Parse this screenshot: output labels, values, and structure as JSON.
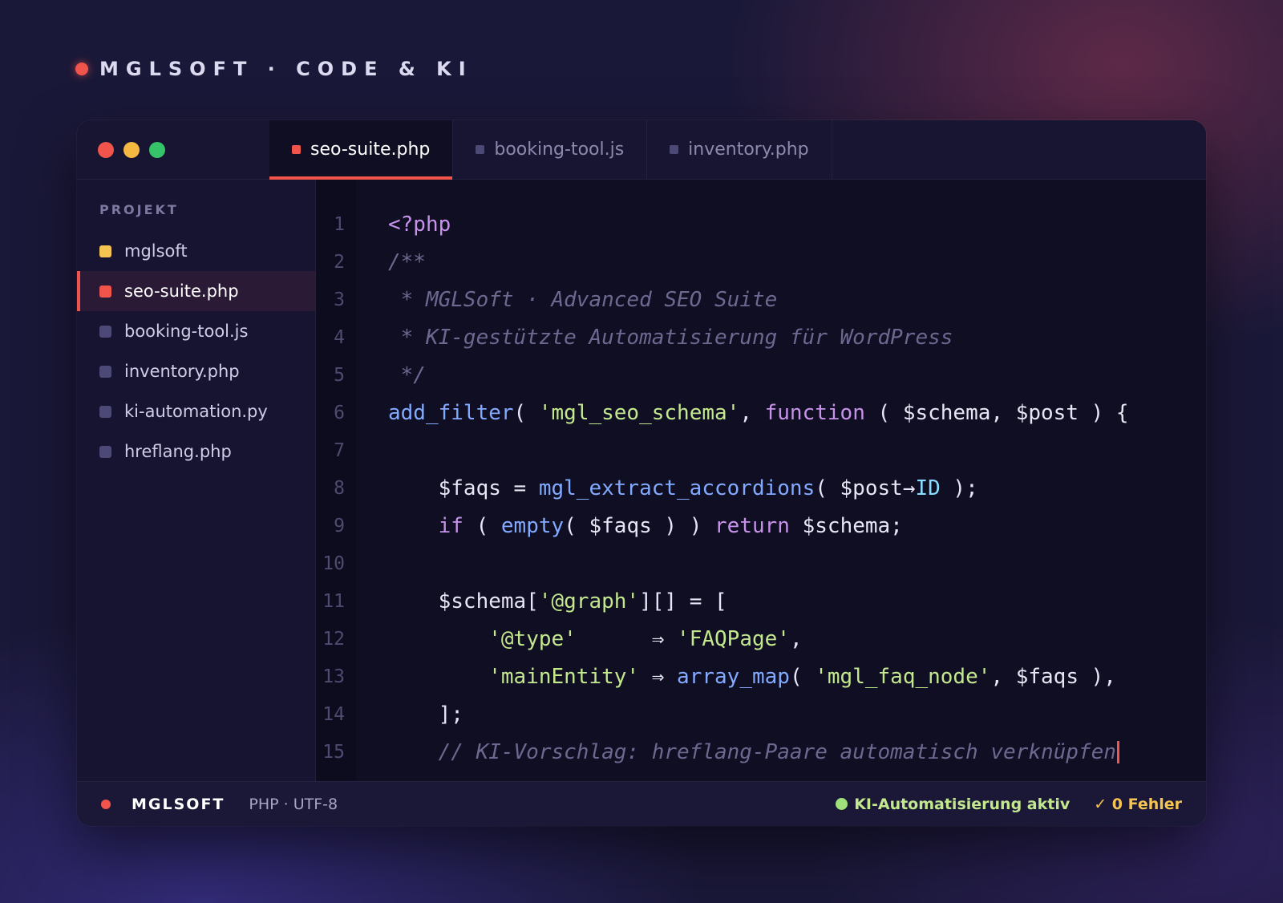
{
  "brand": {
    "title": "MGLSOFT · CODE & KI"
  },
  "tabs": [
    {
      "label": "seo-suite.php",
      "active": true
    },
    {
      "label": "booking-tool.js",
      "active": false
    },
    {
      "label": "inventory.php",
      "active": false
    }
  ],
  "sidebar": {
    "section_label": "PROJEKT",
    "items": [
      {
        "label": "mglsoft",
        "type": "folder"
      },
      {
        "label": "seo-suite.php",
        "active": true
      },
      {
        "label": "booking-tool.js"
      },
      {
        "label": "inventory.php"
      },
      {
        "label": "ki-automation.py"
      },
      {
        "label": "hreflang.php"
      }
    ]
  },
  "code": {
    "line_numbers": [
      "1",
      "2",
      "3",
      "4",
      "5",
      "6",
      "7",
      "8",
      "9",
      "10",
      "11",
      "12",
      "13",
      "14",
      "15"
    ],
    "lines": [
      [
        [
          "k",
          "<?php"
        ]
      ],
      [
        [
          "c",
          "/**"
        ]
      ],
      [
        [
          "c",
          " * MGLSoft · Advanced SEO Suite"
        ]
      ],
      [
        [
          "c",
          " * KI-gestützte Automatisierung für WordPress"
        ]
      ],
      [
        [
          "c",
          " */"
        ]
      ],
      [
        [
          "f",
          "add_filter"
        ],
        [
          "t",
          "( "
        ],
        [
          "s",
          "'mgl_seo_schema'"
        ],
        [
          "t",
          ", "
        ],
        [
          "k",
          "function"
        ],
        [
          "t",
          " ( $schema, $post ) {"
        ]
      ],
      [],
      [
        [
          "t",
          "    $faqs = "
        ],
        [
          "f",
          "mgl_extract_accordions"
        ],
        [
          "t",
          "( $post"
        ],
        [
          "t",
          "→"
        ],
        [
          "p",
          "ID"
        ],
        [
          "t",
          " );"
        ]
      ],
      [
        [
          "t",
          "    "
        ],
        [
          "k",
          "if"
        ],
        [
          "t",
          " ( "
        ],
        [
          "f",
          "empty"
        ],
        [
          "t",
          "( $faqs ) ) "
        ],
        [
          "k",
          "return"
        ],
        [
          "t",
          " $schema;"
        ]
      ],
      [],
      [
        [
          "t",
          "    $schema["
        ],
        [
          "s",
          "'@graph'"
        ],
        [
          "t",
          "][] = ["
        ]
      ],
      [
        [
          "t",
          "        "
        ],
        [
          "s",
          "'@type'"
        ],
        [
          "t",
          "      ⇒ "
        ],
        [
          "s",
          "'FAQPage'"
        ],
        [
          "t",
          ","
        ]
      ],
      [
        [
          "t",
          "        "
        ],
        [
          "s",
          "'mainEntity'"
        ],
        [
          "t",
          " ⇒ "
        ],
        [
          "f",
          "array_map"
        ],
        [
          "t",
          "( "
        ],
        [
          "s",
          "'mgl_faq_node'"
        ],
        [
          "t",
          ", $faqs ),"
        ]
      ],
      [
        [
          "t",
          "    ];"
        ]
      ],
      [
        [
          "c",
          "    // KI-Vorschlag: hreflang-Paare automatisch verknüpfen"
        ]
      ]
    ]
  },
  "statusbar": {
    "brand": "MGLSOFT",
    "language": "PHP · UTF-8",
    "ai_status": "KI-Automatisierung aktiv",
    "errors": "✓ 0 Fehler"
  },
  "colors": {
    "accent": "#f0544a",
    "folder": "#f5c451",
    "keyword": "#c792ea",
    "function": "#82aaff",
    "string": "#c3e88d",
    "comment": "#6c6890",
    "ok": "#9fe07a"
  }
}
